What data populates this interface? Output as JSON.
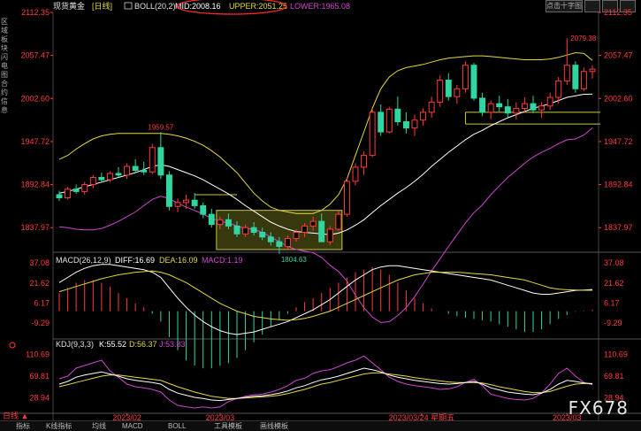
{
  "header": {
    "instrument": "现货黄金",
    "period_tag": "[日线]",
    "boll_label": "BOLL(20,2)",
    "mid_label": "MID:2008.16",
    "upper_label": "UPPER:2051.25",
    "lower_label": "LOWER:1965.08",
    "search_label": "点击十字图"
  },
  "left_strip": [
    "区",
    "域",
    "板",
    "块",
    "闪",
    "电",
    "图",
    "合",
    "约",
    "信",
    "息"
  ],
  "footer": {
    "period_button": "日线 ▲",
    "dates": [
      "2023/02",
      "2023/03",
      "2023/03/24 星期五",
      "2023/03"
    ],
    "tabs": [
      "指标",
      "K线指标",
      "均线",
      "MACD",
      "BOLL",
      "工具模板",
      "画线模板"
    ]
  },
  "watermark": "FX678",
  "colors": {
    "up": "#ff3b3b",
    "down": "#30d5a0",
    "mid": "#ffffff",
    "upper": "#e5d93a",
    "lower": "#d046d0",
    "axis": "#ff3b3b",
    "annotation": "#ff3b3b",
    "box": "#c9c93a"
  },
  "chart_data": [
    {
      "type": "candlestick",
      "title": "现货黄金 日线 BOLL(20,2)",
      "ylim": [
        1810,
        2112.35
      ],
      "y_ticks": [
        "2112.35",
        "2057.47",
        "2002.60",
        "1947.72",
        "1892.84",
        "1837.97"
      ],
      "x_ticks": [
        "2023/02",
        "2023/03",
        "2023/03/24 星期五",
        "2023/03"
      ],
      "annotations": [
        "1959.57",
        "1804.63",
        "2079.38"
      ],
      "candles": [
        [
          1880,
          1885,
          1872,
          1876
        ],
        [
          1876,
          1890,
          1874,
          1887
        ],
        [
          1887,
          1893,
          1881,
          1884
        ],
        [
          1884,
          1896,
          1880,
          1893
        ],
        [
          1893,
          1905,
          1888,
          1902
        ],
        [
          1902,
          1908,
          1895,
          1899
        ],
        [
          1899,
          1910,
          1896,
          1907
        ],
        [
          1907,
          1915,
          1902,
          1905
        ],
        [
          1905,
          1920,
          1900,
          1916
        ],
        [
          1916,
          1925,
          1908,
          1911
        ],
        [
          1911,
          1922,
          1905,
          1909
        ],
        [
          1909,
          1945,
          1906,
          1940
        ],
        [
          1940,
          1959.57,
          1900,
          1905
        ],
        [
          1905,
          1910,
          1860,
          1865
        ],
        [
          1865,
          1875,
          1858,
          1870
        ],
        [
          1870,
          1880,
          1862,
          1873
        ],
        [
          1873,
          1882,
          1862,
          1866
        ],
        [
          1866,
          1870,
          1850,
          1855
        ],
        [
          1855,
          1862,
          1838,
          1842
        ],
        [
          1842,
          1852,
          1836,
          1848
        ],
        [
          1848,
          1856,
          1836,
          1840
        ],
        [
          1840,
          1846,
          1826,
          1830
        ],
        [
          1830,
          1842,
          1826,
          1838
        ],
        [
          1838,
          1845,
          1828,
          1832
        ],
        [
          1832,
          1838,
          1822,
          1826
        ],
        [
          1826,
          1832,
          1815,
          1820
        ],
        [
          1820,
          1826,
          1804.63,
          1814
        ],
        [
          1814,
          1828,
          1810,
          1824
        ],
        [
          1824,
          1836,
          1820,
          1832
        ],
        [
          1832,
          1844,
          1826,
          1840
        ],
        [
          1840,
          1852,
          1834,
          1846
        ],
        [
          1846,
          1856,
          1826,
          1820
        ],
        [
          1820,
          1840,
          1816,
          1836
        ],
        [
          1836,
          1860,
          1834,
          1855
        ],
        [
          1855,
          1902,
          1852,
          1897
        ],
        [
          1897,
          1920,
          1892,
          1915
        ],
        [
          1915,
          1935,
          1905,
          1930
        ],
        [
          1930,
          1990,
          1928,
          1985
        ],
        [
          1985,
          1995,
          1955,
          1960
        ],
        [
          1960,
          1992,
          1958,
          1989
        ],
        [
          1989,
          2005,
          1968,
          1973
        ],
        [
          1973,
          1985,
          1958,
          1965
        ],
        [
          1965,
          1982,
          1955,
          1975
        ],
        [
          1975,
          1990,
          1968,
          1985
        ],
        [
          1985,
          2005,
          1978,
          1998
        ],
        [
          1998,
          2032,
          1992,
          2026
        ],
        [
          2026,
          2035,
          2000,
          2005
        ],
        [
          2005,
          2020,
          1996,
          2015
        ],
        [
          2015,
          2050,
          2010,
          2045
        ],
        [
          2045,
          2048,
          2000,
          2003
        ],
        [
          2003,
          2010,
          1980,
          1985
        ],
        [
          1985,
          2000,
          1976,
          1996
        ],
        [
          1996,
          2006,
          1986,
          1992
        ],
        [
          1992,
          2002,
          1978,
          1984
        ],
        [
          1984,
          1998,
          1976,
          1990
        ],
        [
          1990,
          2004,
          1984,
          1996
        ],
        [
          1996,
          2006,
          1984,
          1988
        ],
        [
          1988,
          1998,
          1978,
          1993
        ],
        [
          1993,
          2010,
          1988,
          2004
        ],
        [
          2004,
          2030,
          1996,
          2025
        ],
        [
          2025,
          2079.38,
          2020,
          2045
        ],
        [
          2045,
          2050,
          2010,
          2015
        ],
        [
          2015,
          2042,
          2012,
          2037
        ],
        [
          2037,
          2045,
          2028,
          2040
        ]
      ],
      "boll_mid": [
        1882,
        1884,
        1887,
        1890,
        1893,
        1896,
        1899,
        1902,
        1905,
        1908,
        1912,
        1916,
        1918,
        1916,
        1912,
        1908,
        1904,
        1899,
        1893,
        1887,
        1881,
        1874,
        1866,
        1859,
        1852,
        1845,
        1840,
        1836,
        1833,
        1832,
        1831,
        1830,
        1829,
        1831,
        1835,
        1841,
        1848,
        1857,
        1866,
        1874,
        1882,
        1889,
        1897,
        1906,
        1916,
        1925,
        1934,
        1942,
        1950,
        1957,
        1962,
        1968,
        1973,
        1978,
        1982,
        1986,
        1990,
        1993,
        1996,
        2000,
        2004,
        2006,
        2008,
        2008.16
      ],
      "boll_upper": [
        1925,
        1930,
        1938,
        1945,
        1951,
        1955,
        1957,
        1958,
        1958,
        1958,
        1958,
        1958,
        1958,
        1957,
        1955,
        1952,
        1948,
        1943,
        1936,
        1928,
        1918,
        1908,
        1895,
        1882,
        1872,
        1864,
        1860,
        1858,
        1856,
        1856,
        1856,
        1860,
        1868,
        1880,
        1900,
        1930,
        1960,
        1990,
        2015,
        2030,
        2038,
        2042,
        2044,
        2046,
        2049,
        2052,
        2054,
        2055,
        2056,
        2057,
        2057,
        2056,
        2055,
        2054,
        2053,
        2052,
        2052,
        2052,
        2053,
        2055,
        2058,
        2061,
        2060,
        2051.25
      ],
      "boll_lower": [
        1839,
        1838,
        1836,
        1835,
        1835,
        1837,
        1841,
        1846,
        1852,
        1858,
        1866,
        1874,
        1878,
        1875,
        1869,
        1864,
        1860,
        1855,
        1850,
        1846,
        1844,
        1840,
        1837,
        1836,
        1832,
        1826,
        1820,
        1814,
        1810,
        1808,
        1806,
        1800,
        1790,
        1782,
        1770,
        1752,
        1736,
        1724,
        1717,
        1718,
        1726,
        1736,
        1750,
        1766,
        1783,
        1798,
        1814,
        1829,
        1844,
        1857,
        1867,
        1880,
        1891,
        1902,
        1911,
        1920,
        1928,
        1934,
        1939,
        1945,
        1950,
        1951,
        1956,
        1965.08
      ]
    },
    {
      "type": "macd",
      "title": "MACD(26,12,9)",
      "labels": [
        "DIFF:16.69",
        "DEA:16.09",
        "MACD:1.19"
      ],
      "y_ticks": [
        "37.08",
        "21.62",
        "6.17",
        "-9.29"
      ],
      "ylim": [
        -18,
        42
      ],
      "diff": [
        22,
        26,
        30,
        33,
        35,
        36,
        36,
        35,
        34,
        33,
        32,
        30,
        26,
        18,
        10,
        3,
        -3,
        -8,
        -12,
        -15,
        -17,
        -18,
        -17,
        -16,
        -14,
        -12,
        -10,
        -8,
        -5,
        -2,
        1,
        5,
        9,
        14,
        19,
        24,
        28,
        32,
        34,
        35,
        35,
        34,
        33,
        32,
        31,
        30,
        29,
        28,
        27,
        26,
        25,
        24,
        22,
        20,
        18,
        16,
        14,
        13,
        13,
        14,
        15,
        16,
        16.3,
        16.69
      ],
      "dea": [
        15,
        17,
        19,
        21,
        23,
        25,
        26.5,
        28,
        29,
        30,
        30.5,
        31,
        30,
        28,
        25,
        22,
        18,
        14,
        10,
        6,
        3,
        0,
        -2,
        -4,
        -5,
        -6,
        -6.5,
        -7,
        -6.5,
        -5.5,
        -4,
        -2,
        0,
        3,
        6,
        9,
        12,
        15,
        18,
        21,
        24,
        26,
        28,
        29,
        30,
        30,
        30,
        30,
        29.5,
        29,
        28.5,
        28,
        27,
        26,
        25,
        24,
        22,
        20,
        18,
        17,
        16.5,
        16.2,
        16.1,
        16.09
      ]
    },
    {
      "type": "kdj",
      "title": "KDJ(9,3,3)",
      "labels": [
        "K:55.52",
        "D:56.37",
        "J:53.83"
      ],
      "y_ticks": [
        "110.69",
        "69.81",
        "28.94"
      ],
      "ylim": [
        5,
        125
      ],
      "k": [
        55,
        60,
        68,
        72,
        75,
        78,
        74,
        70,
        65,
        62,
        60,
        58,
        55,
        45,
        38,
        34,
        30,
        28,
        25,
        24,
        26,
        28,
        30,
        32,
        33,
        35,
        38,
        42,
        48,
        52,
        58,
        63,
        66,
        70,
        75,
        80,
        85,
        82,
        78,
        72,
        68,
        65,
        62,
        60,
        58,
        56,
        55,
        56,
        58,
        60,
        55,
        48,
        44,
        40,
        38,
        36,
        35,
        38,
        45,
        55,
        62,
        60,
        57,
        55.52
      ],
      "d": [
        50,
        54,
        58,
        62,
        66,
        70,
        72,
        72,
        70,
        68,
        66,
        64,
        62,
        56,
        50,
        45,
        40,
        36,
        32,
        30,
        28,
        28,
        29,
        30,
        31,
        32,
        34,
        37,
        41,
        45,
        50,
        55,
        58,
        62,
        66,
        70,
        74,
        76,
        76,
        74,
        72,
        70,
        67,
        65,
        63,
        61,
        59,
        58,
        58,
        58,
        57,
        54,
        50,
        47,
        44,
        41,
        39,
        39,
        41,
        46,
        51,
        55,
        56,
        56.37
      ],
      "j": [
        65,
        70,
        85,
        90,
        95,
        100,
        80,
        68,
        55,
        50,
        48,
        45,
        40,
        25,
        15,
        12,
        10,
        12,
        10,
        12,
        22,
        28,
        32,
        35,
        36,
        40,
        45,
        52,
        62,
        66,
        75,
        80,
        82,
        88,
        95,
        100,
        108,
        95,
        82,
        68,
        60,
        55,
        52,
        50,
        48,
        45,
        46,
        50,
        58,
        64,
        52,
        36,
        32,
        28,
        26,
        25,
        28,
        38,
        55,
        75,
        85,
        70,
        58,
        53.83
      ]
    }
  ]
}
